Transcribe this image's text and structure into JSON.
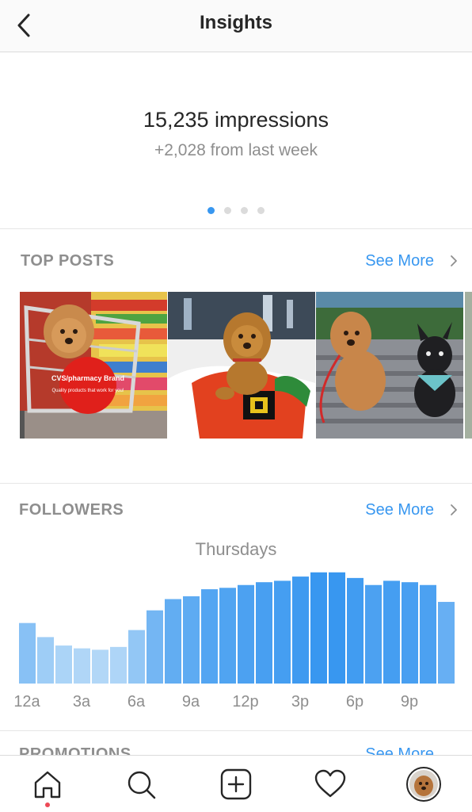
{
  "header": {
    "title": "Insights",
    "back_icon": "chevron-left-icon"
  },
  "impressions": {
    "main": "15,235 impressions",
    "sub": "+2,028 from last week",
    "pager": {
      "count": 4,
      "active": 1
    }
  },
  "top_posts": {
    "title": "TOP POSTS",
    "see_more": "See More",
    "posts": [
      {
        "label": "CVS/pharmacy Brand",
        "sub": "Quality products that work for you!"
      },
      {
        "label": ""
      },
      {
        "label": ""
      }
    ]
  },
  "followers": {
    "title": "FOLLOWERS",
    "see_more": "See More"
  },
  "promotions": {
    "title": "PROMOTIONS",
    "see_more": "See More"
  },
  "chart_data": {
    "type": "bar",
    "title": "Thursdays",
    "categories": [
      "12a",
      "1a",
      "2a",
      "3a",
      "4a",
      "5a",
      "6a",
      "7a",
      "8a",
      "9a",
      "10a",
      "11a",
      "12p",
      "1p",
      "2p",
      "3p",
      "4p",
      "5p",
      "6p",
      "7p",
      "8p",
      "9p",
      "10p",
      "11p"
    ],
    "tick_labels": [
      "12a",
      "3a",
      "6a",
      "9a",
      "12p",
      "3p",
      "6p",
      "9p"
    ],
    "values": [
      43,
      33,
      27,
      25,
      24,
      26,
      38,
      52,
      60,
      62,
      67,
      68,
      70,
      72,
      73,
      76,
      79,
      79,
      75,
      70,
      73,
      72,
      70,
      58
    ],
    "ylim": [
      0,
      80
    ],
    "grid": false,
    "colors": {
      "low": "#b2d7f7",
      "high": "#3897f0"
    }
  },
  "tabbar": {
    "items": [
      "home-icon",
      "search-icon",
      "add-post-icon",
      "heart-icon",
      "profile-avatar"
    ],
    "accent": "#ed4956"
  }
}
